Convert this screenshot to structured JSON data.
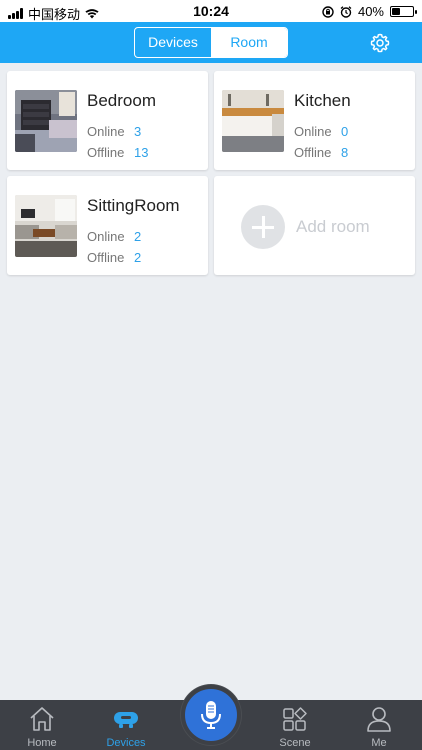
{
  "status_bar": {
    "carrier": "中国移动",
    "time": "10:24",
    "battery": "40%",
    "battery_level": 0.4
  },
  "header": {
    "tabs": [
      {
        "label": "Devices",
        "active": false
      },
      {
        "label": "Room",
        "active": true
      }
    ]
  },
  "rooms": [
    {
      "name": "Bedroom",
      "online_label": "Online",
      "online": "3",
      "offline_label": "Offline",
      "offline": "13"
    },
    {
      "name": "Kitchen",
      "online_label": "Online",
      "online": "0",
      "offline_label": "Offline",
      "offline": "8"
    },
    {
      "name": "SittingRoom",
      "online_label": "Online",
      "online": "2",
      "offline_label": "Offline",
      "offline": "2"
    }
  ],
  "add_room": {
    "label": "Add room"
  },
  "tabbar": {
    "items": [
      {
        "label": "Home"
      },
      {
        "label": "Devices"
      },
      {
        "label": "Scene"
      },
      {
        "label": "Me"
      }
    ]
  },
  "colors": {
    "accent": "#1ea7f5",
    "link": "#2ea1e8",
    "tabbar_bg": "#3d4046",
    "mic": "#2f72d8"
  }
}
